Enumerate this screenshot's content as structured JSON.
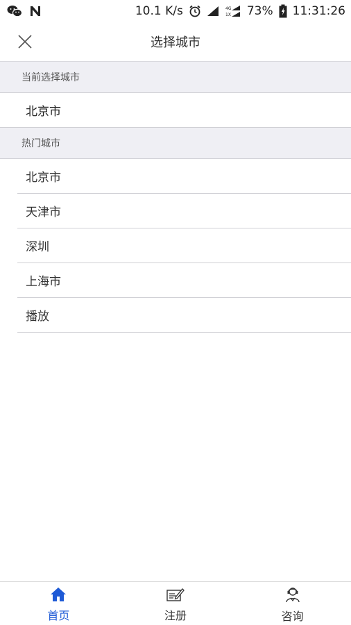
{
  "status_bar": {
    "network_speed": "10.1 K/s",
    "battery": "73%",
    "time": "11:31:26",
    "icons": [
      "wechat-icon",
      "n-icon",
      "alarm-icon",
      "signal-icon",
      "4g-1x-signal-icon",
      "battery-icon"
    ]
  },
  "header": {
    "title": "选择城市",
    "close_icon": "close-icon"
  },
  "current": {
    "section_label": "当前选择城市",
    "city": "北京市"
  },
  "hot": {
    "section_label": "热门城市",
    "cities": [
      "北京市",
      "天津市",
      "深圳",
      "上海市",
      "播放"
    ]
  },
  "tab_bar": {
    "items": [
      {
        "label": "首页",
        "icon": "home-icon",
        "active": true
      },
      {
        "label": "注册",
        "icon": "register-icon",
        "active": false
      },
      {
        "label": "咨询",
        "icon": "consult-icon",
        "active": false
      }
    ],
    "accent_color": "#1e5ad6"
  }
}
